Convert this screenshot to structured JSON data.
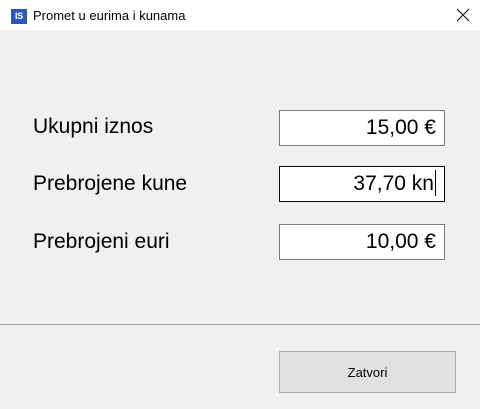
{
  "window": {
    "icon_text": "IS",
    "title": "Promet u eurima i kunama"
  },
  "fields": [
    {
      "label": "Ukupni iznos",
      "value": "15,00 €"
    },
    {
      "label": "Prebrojene kune",
      "value": "37,70 kn"
    },
    {
      "label": "Prebrojeni euri",
      "value": "10,00 €"
    }
  ],
  "footer": {
    "close_label": "Zatvori"
  },
  "icons": {
    "app": "app-icon",
    "close": "close-icon"
  },
  "colors": {
    "app_icon_bg": "#2a58b4",
    "window_bg": "#f0f0f0",
    "button_bg": "#e1e1e1"
  }
}
